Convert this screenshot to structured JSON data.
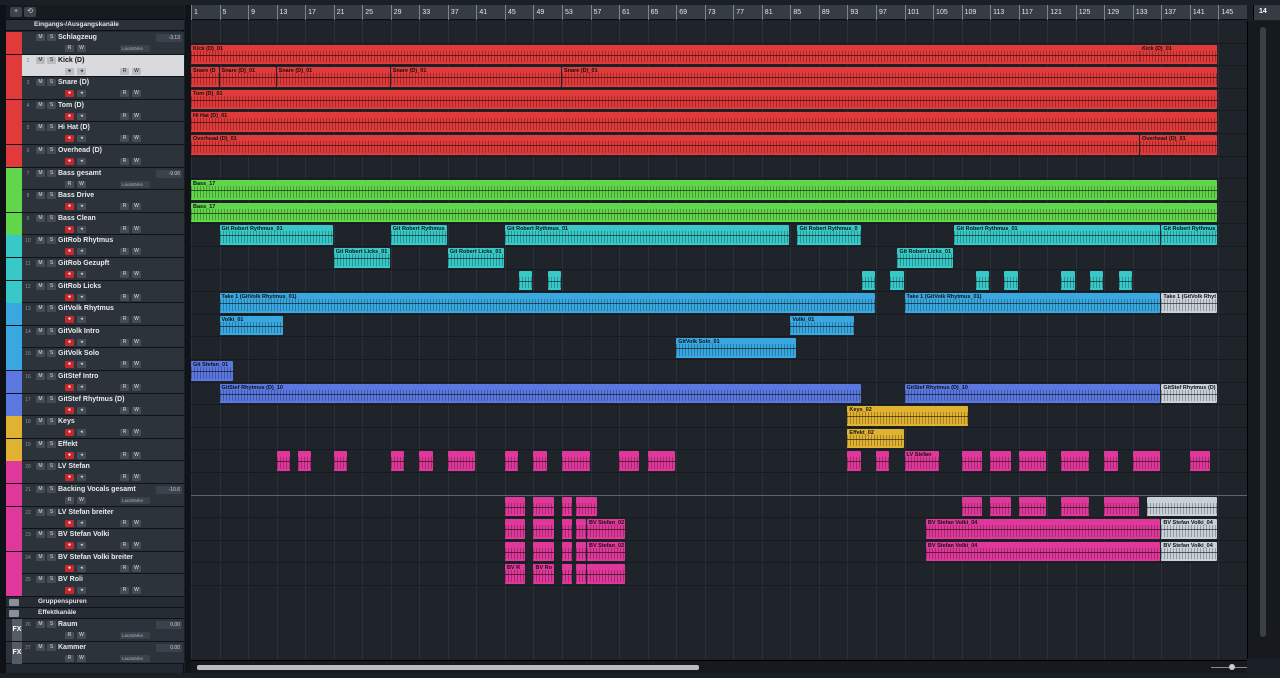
{
  "header_buttons": [
    "+",
    "⟲"
  ],
  "folder_label": "Eingangs-/Ausgangskanäle",
  "tracks": [
    {
      "num": "",
      "name": "Schlagzeug",
      "color": "#e03a3a",
      "kind": "group",
      "vol": "-3.13"
    },
    {
      "num": "2",
      "name": "Kick (D)",
      "color": "#e03a3a",
      "kind": "audio",
      "selected": true
    },
    {
      "num": "3",
      "name": "Snare (D)",
      "color": "#e03a3a",
      "kind": "audio"
    },
    {
      "num": "4",
      "name": "Tom (D)",
      "color": "#e03a3a",
      "kind": "audio"
    },
    {
      "num": "5",
      "name": "Hi Hat (D)",
      "color": "#e03a3a",
      "kind": "audio"
    },
    {
      "num": "6",
      "name": "Overhead (D)",
      "color": "#e03a3a",
      "kind": "audio"
    },
    {
      "num": "7",
      "name": "Bass gesamt",
      "color": "#62d64a",
      "kind": "group",
      "vol": "-9.06"
    },
    {
      "num": "8",
      "name": "Bass Drive",
      "color": "#62d64a",
      "kind": "audio"
    },
    {
      "num": "9",
      "name": "Bass Clean",
      "color": "#62d64a",
      "kind": "audio"
    },
    {
      "num": "10",
      "name": "GitRob Rhytmus",
      "color": "#38c8c8",
      "kind": "audio"
    },
    {
      "num": "11",
      "name": "GitRob Gezupft",
      "color": "#38c8c8",
      "kind": "audio"
    },
    {
      "num": "12",
      "name": "GitRob Licks",
      "color": "#38c8c8",
      "kind": "audio"
    },
    {
      "num": "13",
      "name": "GitVolk Rhytmus",
      "color": "#3aa8e0",
      "kind": "audio"
    },
    {
      "num": "14",
      "name": "GitVolk Intro",
      "color": "#3aa8e0",
      "kind": "audio"
    },
    {
      "num": "15",
      "name": "GitVolk Solo",
      "color": "#3aa8e0",
      "kind": "audio"
    },
    {
      "num": "16",
      "name": "GitStef Intro",
      "color": "#5a78e0",
      "kind": "audio"
    },
    {
      "num": "17",
      "name": "GitStef Rhytmus (D)",
      "color": "#5a78e0",
      "kind": "audio"
    },
    {
      "num": "18",
      "name": "Keys",
      "color": "#e0b232",
      "kind": "audio"
    },
    {
      "num": "19",
      "name": "Effekt",
      "color": "#e0b232",
      "kind": "audio"
    },
    {
      "num": "20",
      "name": "LV Stefan",
      "color": "#e0389a",
      "kind": "audio"
    },
    {
      "num": "21",
      "name": "Backing Vocals gesamt",
      "color": "#e0389a",
      "kind": "group",
      "vol": "-10.6"
    },
    {
      "num": "22",
      "name": "LV Stefan breiter",
      "color": "#e0389a",
      "kind": "audio"
    },
    {
      "num": "23",
      "name": "BV Stefan Volki",
      "color": "#e0389a",
      "kind": "audio"
    },
    {
      "num": "24",
      "name": "BV Stefan Volki breiter",
      "color": "#e0389a",
      "kind": "audio"
    },
    {
      "num": "25",
      "name": "BV Roli",
      "color": "#e0389a",
      "kind": "audio"
    }
  ],
  "folders": [
    {
      "name": "Gruppenspuren"
    },
    {
      "name": "Effektkanäle"
    }
  ],
  "fx_tracks": [
    {
      "num": "26",
      "name": "Raum",
      "vol": "0.00",
      "label": "Lautstärke",
      "badge": "FX"
    },
    {
      "num": "27",
      "name": "Kammer",
      "vol": "0.00",
      "label": "Lautstärke",
      "badge": "FX"
    }
  ],
  "group_label": "Lautstärke",
  "button_labels": {
    "mute": "M",
    "solo": "S",
    "read": "R",
    "write": "W",
    "rec": "●",
    "mon": "◂"
  },
  "ruler_bars": [
    "1",
    "5",
    "9",
    "13",
    "17",
    "21",
    "25",
    "29",
    "33",
    "37",
    "41",
    "45",
    "49",
    "53",
    "57",
    "61",
    "65",
    "69",
    "73",
    "77",
    "81",
    "85",
    "89",
    "93",
    "97",
    "101",
    "105",
    "109",
    "113",
    "117",
    "121",
    "125",
    "129",
    "133",
    "137",
    "141",
    "145"
  ],
  "ruler_right": "14",
  "events": [
    {
      "row": 1,
      "s": 1,
      "e": 145,
      "name": "Kick (D)_01",
      "color": "#e03a3a"
    },
    {
      "row": 1,
      "s": 134,
      "e": 145,
      "name": "Kick (D)_01",
      "color": "#e03a3a"
    },
    {
      "row": 2,
      "s": 1,
      "e": 5,
      "name": "Snare (D",
      "color": "#e03a3a"
    },
    {
      "row": 2,
      "s": 5,
      "e": 13,
      "name": "Snare (D)_01",
      "color": "#e03a3a"
    },
    {
      "row": 2,
      "s": 13,
      "e": 29,
      "name": "Snare (D)_01",
      "color": "#e03a3a"
    },
    {
      "row": 2,
      "s": 29,
      "e": 53,
      "name": "Snare (D)_01",
      "color": "#e03a3a"
    },
    {
      "row": 2,
      "s": 53,
      "e": 145,
      "name": "Snare (D)_01",
      "color": "#e03a3a"
    },
    {
      "row": 3,
      "s": 1,
      "e": 145,
      "name": "Tom (D)_01",
      "color": "#e03a3a"
    },
    {
      "row": 4,
      "s": 1,
      "e": 145,
      "name": "Hi Hat (D)_01",
      "color": "#e03a3a"
    },
    {
      "row": 5,
      "s": 1,
      "e": 134,
      "name": "Overhead (D)_01",
      "color": "#e03a3a"
    },
    {
      "row": 5,
      "s": 134,
      "e": 145,
      "name": "Overhead (D)_01",
      "color": "#e03a3a"
    },
    {
      "row": 7,
      "s": 1,
      "e": 145,
      "name": "Bass_17",
      "color": "#62d64a"
    },
    {
      "row": 8,
      "s": 1,
      "e": 145,
      "name": "Bass_17",
      "color": "#62d64a"
    },
    {
      "row": 9,
      "s": 5,
      "e": 21,
      "name": "Git Robert Rythmus_01",
      "color": "#38c8c8"
    },
    {
      "row": 9,
      "s": 29,
      "e": 37,
      "name": "Git Robert Rythmus",
      "color": "#38c8c8"
    },
    {
      "row": 9,
      "s": 45,
      "e": 85,
      "name": "Git Robert Rythmus_01",
      "color": "#38c8c8"
    },
    {
      "row": 9,
      "s": 86,
      "e": 95,
      "name": "Git Robert Rythmus_0",
      "color": "#38c8c8"
    },
    {
      "row": 9,
      "s": 108,
      "e": 137,
      "name": "Git Robert Rythmus_01",
      "color": "#38c8c8"
    },
    {
      "row": 9,
      "s": 137,
      "e": 145,
      "name": "Git Robert Rythmus_0",
      "color": "#38c8c8"
    },
    {
      "row": 10,
      "s": 21,
      "e": 29,
      "name": "Git Robert Licks_01",
      "color": "#38c8c8"
    },
    {
      "row": 10,
      "s": 37,
      "e": 45,
      "name": "Git Robert Licks_01",
      "color": "#38c8c8"
    },
    {
      "row": 10,
      "s": 100,
      "e": 108,
      "name": "Git Robert Licks_01",
      "color": "#38c8c8"
    },
    {
      "row": 11,
      "s": 47,
      "e": 49,
      "name": "",
      "color": "#38c8c8"
    },
    {
      "row": 11,
      "s": 51,
      "e": 53,
      "name": "",
      "color": "#38c8c8"
    },
    {
      "row": 11,
      "s": 95,
      "e": 97,
      "name": "",
      "color": "#38c8c8"
    },
    {
      "row": 11,
      "s": 99,
      "e": 101,
      "name": "",
      "color": "#38c8c8"
    },
    {
      "row": 11,
      "s": 111,
      "e": 113,
      "name": "",
      "color": "#38c8c8"
    },
    {
      "row": 11,
      "s": 115,
      "e": 117,
      "name": "",
      "color": "#38c8c8"
    },
    {
      "row": 11,
      "s": 123,
      "e": 125,
      "name": "",
      "color": "#38c8c8"
    },
    {
      "row": 11,
      "s": 127,
      "e": 129,
      "name": "",
      "color": "#38c8c8"
    },
    {
      "row": 11,
      "s": 131,
      "e": 133,
      "name": "",
      "color": "#38c8c8"
    },
    {
      "row": 12,
      "s": 5,
      "e": 97,
      "name": "Take 1 (GitVolk Rhytmus_01)",
      "color": "#3aa8e0"
    },
    {
      "row": 12,
      "s": 101,
      "e": 137,
      "name": "Take 1 (GitVolk Rhytmus_01)",
      "color": "#3aa8e0"
    },
    {
      "row": 12,
      "s": 137,
      "e": 145,
      "name": "Take 1 (GitVolk Rhyt",
      "color": "#c8d0d8"
    },
    {
      "row": 13,
      "s": 5,
      "e": 14,
      "name": "Volki_01",
      "color": "#3aa8e0"
    },
    {
      "row": 13,
      "s": 85,
      "e": 94,
      "name": "Volki_01",
      "color": "#3aa8e0"
    },
    {
      "row": 14,
      "s": 69,
      "e": 86,
      "name": "GitVolk Solo_01",
      "color": "#3aa8e0"
    },
    {
      "row": 15,
      "s": 1,
      "e": 7,
      "name": "Git Stefan_01",
      "color": "#5a78e0"
    },
    {
      "row": 16,
      "s": 5,
      "e": 95,
      "name": "GitStef Rhytmus (D)_10",
      "color": "#5a78e0"
    },
    {
      "row": 16,
      "s": 101,
      "e": 137,
      "name": "GitStef Rhytmus (D)_10",
      "color": "#5a78e0"
    },
    {
      "row": 16,
      "s": 137,
      "e": 145,
      "name": "GitStef Rhytmus (D)",
      "color": "#c8d0d8"
    },
    {
      "row": 17,
      "s": 93,
      "e": 110,
      "name": "Keys_02",
      "color": "#e0b232"
    },
    {
      "row": 18,
      "s": 93,
      "e": 101,
      "name": "Effekt_02",
      "color": "#e0b232"
    },
    {
      "row": 19,
      "s": 13,
      "e": 15,
      "name": "",
      "color": "#e0389a"
    },
    {
      "row": 19,
      "s": 16,
      "e": 18,
      "name": "",
      "color": "#e0389a"
    },
    {
      "row": 19,
      "s": 21,
      "e": 23,
      "name": "",
      "color": "#e0389a"
    },
    {
      "row": 19,
      "s": 29,
      "e": 31,
      "name": "",
      "color": "#e0389a"
    },
    {
      "row": 19,
      "s": 33,
      "e": 35,
      "name": "",
      "color": "#e0389a"
    },
    {
      "row": 19,
      "s": 37,
      "e": 41,
      "name": "",
      "color": "#e0389a"
    },
    {
      "row": 19,
      "s": 45,
      "e": 47,
      "name": "",
      "color": "#e0389a"
    },
    {
      "row": 19,
      "s": 49,
      "e": 51,
      "name": "",
      "color": "#e0389a"
    },
    {
      "row": 19,
      "s": 53,
      "e": 57,
      "name": "",
      "color": "#e0389a"
    },
    {
      "row": 19,
      "s": 61,
      "e": 64,
      "name": "",
      "color": "#e0389a"
    },
    {
      "row": 19,
      "s": 65,
      "e": 69,
      "name": "",
      "color": "#e0389a"
    },
    {
      "row": 19,
      "s": 93,
      "e": 95,
      "name": "",
      "color": "#e0389a"
    },
    {
      "row": 19,
      "s": 97,
      "e": 99,
      "name": "",
      "color": "#e0389a"
    },
    {
      "row": 19,
      "s": 101,
      "e": 106,
      "name": "LV Stefan",
      "color": "#e0389a"
    },
    {
      "row": 19,
      "s": 109,
      "e": 112,
      "name": "",
      "color": "#e0389a"
    },
    {
      "row": 19,
      "s": 113,
      "e": 116,
      "name": "",
      "color": "#e0389a"
    },
    {
      "row": 19,
      "s": 117,
      "e": 121,
      "name": "",
      "color": "#e0389a"
    },
    {
      "row": 19,
      "s": 123,
      "e": 127,
      "name": "",
      "color": "#e0389a"
    },
    {
      "row": 19,
      "s": 129,
      "e": 131,
      "name": "",
      "color": "#e0389a"
    },
    {
      "row": 19,
      "s": 133,
      "e": 137,
      "name": "",
      "color": "#e0389a"
    },
    {
      "row": 19,
      "s": 141,
      "e": 144,
      "name": "",
      "color": "#e0389a"
    },
    {
      "row": 21,
      "s": 45,
      "e": 48,
      "name": "",
      "color": "#e0389a"
    },
    {
      "row": 21,
      "s": 49,
      "e": 52,
      "name": "",
      "color": "#e0389a"
    },
    {
      "row": 21,
      "s": 53,
      "e": 54.5,
      "name": "",
      "color": "#e0389a"
    },
    {
      "row": 21,
      "s": 55,
      "e": 58,
      "name": "",
      "color": "#e0389a"
    },
    {
      "row": 21,
      "s": 109,
      "e": 112,
      "name": "",
      "color": "#e0389a"
    },
    {
      "row": 21,
      "s": 113,
      "e": 116,
      "name": "",
      "color": "#e0389a"
    },
    {
      "row": 21,
      "s": 117,
      "e": 121,
      "name": "",
      "color": "#e0389a"
    },
    {
      "row": 21,
      "s": 123,
      "e": 127,
      "name": "",
      "color": "#e0389a"
    },
    {
      "row": 21,
      "s": 129,
      "e": 134,
      "name": "",
      "color": "#e0389a"
    },
    {
      "row": 21,
      "s": 135,
      "e": 145,
      "name": "",
      "color": "#c8d0d8"
    },
    {
      "row": 22,
      "s": 45,
      "e": 48,
      "name": "",
      "color": "#e0389a"
    },
    {
      "row": 22,
      "s": 49,
      "e": 52,
      "name": "",
      "color": "#e0389a"
    },
    {
      "row": 22,
      "s": 53,
      "e": 54.5,
      "name": "",
      "color": "#e0389a"
    },
    {
      "row": 22,
      "s": 55,
      "e": 56.5,
      "name": "",
      "color": "#e0389a"
    },
    {
      "row": 22,
      "s": 56.5,
      "e": 62,
      "name": "BV Stefan_02",
      "color": "#e0389a"
    },
    {
      "row": 22,
      "s": 104,
      "e": 137,
      "name": "BV Stefan Volki_04",
      "color": "#e0389a"
    },
    {
      "row": 22,
      "s": 137,
      "e": 145,
      "name": "BV Stefan Volki_04",
      "color": "#c8d0d8"
    },
    {
      "row": 23,
      "s": 45,
      "e": 48,
      "name": "",
      "color": "#e0389a"
    },
    {
      "row": 23,
      "s": 49,
      "e": 52,
      "name": "",
      "color": "#e0389a"
    },
    {
      "row": 23,
      "s": 53,
      "e": 54.5,
      "name": "",
      "color": "#e0389a"
    },
    {
      "row": 23,
      "s": 55,
      "e": 56.5,
      "name": "",
      "color": "#e0389a"
    },
    {
      "row": 23,
      "s": 56.5,
      "e": 62,
      "name": "BV Stefan_02",
      "color": "#e0389a"
    },
    {
      "row": 23,
      "s": 104,
      "e": 137,
      "name": "BV Stefan Volki_04",
      "color": "#e0389a"
    },
    {
      "row": 23,
      "s": 137,
      "e": 145,
      "name": "BV Stefan Volki_04",
      "color": "#c8d0d8"
    },
    {
      "row": 24,
      "s": 45,
      "e": 48,
      "name": "BV R",
      "color": "#e0389a"
    },
    {
      "row": 24,
      "s": 49,
      "e": 52,
      "name": "BV Ro",
      "color": "#e0389a"
    },
    {
      "row": 24,
      "s": 53,
      "e": 54.5,
      "name": "",
      "color": "#e0389a"
    },
    {
      "row": 24,
      "s": 55,
      "e": 56.5,
      "name": "",
      "color": "#e0389a"
    },
    {
      "row": 24,
      "s": 56.5,
      "e": 62,
      "name": "",
      "color": "#e0389a"
    }
  ]
}
